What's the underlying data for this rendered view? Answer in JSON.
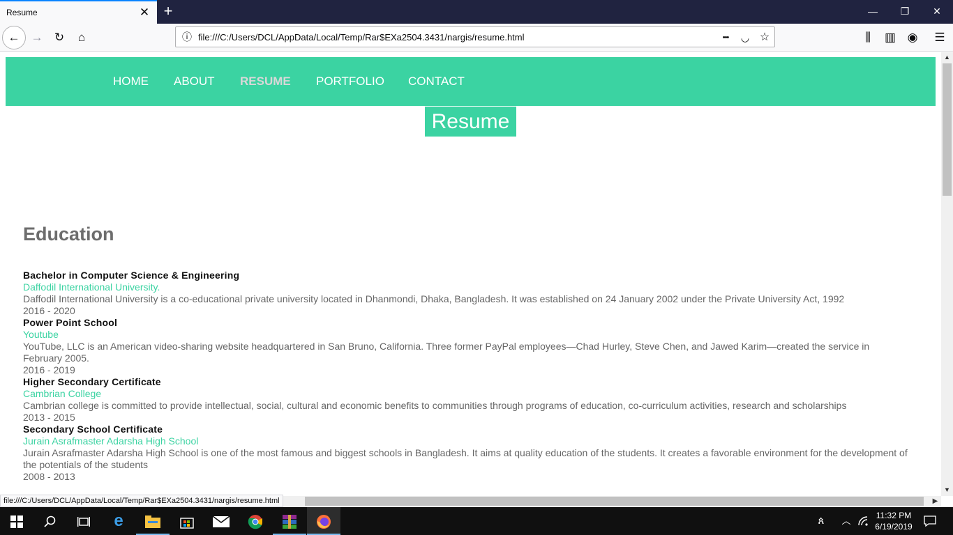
{
  "browser": {
    "tab_title": "Resume",
    "tab_close": "✕",
    "new_tab": "+",
    "url": "file:///C:/Users/DCL/AppData/Local/Temp/Rar$EXa2504.3431/nargis/resume.html",
    "status_url": "file:///C:/Users/DCL/AppData/Local/Temp/Rar$EXa2504.3431/nargis/resume.html",
    "icons": {
      "back": "←",
      "forward": "→",
      "reload": "↻",
      "home": "⌂",
      "info": "ⓘ",
      "more": "•••",
      "pocket": "◡",
      "bookmark": "☆",
      "library": "⫼",
      "sidebar": "▥",
      "account": "◉",
      "menu": "☰",
      "minimize": "—",
      "restore": "❐",
      "close": "✕"
    }
  },
  "nav": {
    "items": [
      "HOME",
      "ABOUT",
      "RESUME",
      "PORTFOLIO",
      "CONTACT"
    ],
    "active": "RESUME"
  },
  "page": {
    "heading": "Resume",
    "section_title": "Education",
    "education": [
      {
        "degree": "Bachelor in Computer Science & Engineering",
        "institution": "Daffodil International University.",
        "description": "Daffodil International University is a co-educational private university located in Dhanmondi, Dhaka, Bangladesh. It was established on 24 January 2002 under the Private University Act, 1992",
        "years": "2016 - 2020"
      },
      {
        "degree": "Power Point School",
        "institution": "Youtube",
        "description": "YouTube, LLC is an American video-sharing website headquartered in San Bruno, California. Three former PayPal employees—Chad Hurley, Steve Chen, and Jawed Karim—created the service in February 2005.",
        "years": "2016 - 2019"
      },
      {
        "degree": "Higher Secondary Certificate",
        "institution": "Cambrian College",
        "description": "Cambrian college is committed to provide intellectual, social, cultural and economic benefits to communities through programs of education, co-curriculum activities, research and scholarships",
        "years": "2013 - 2015"
      },
      {
        "degree": "Secondary School Certificate",
        "institution": "Jurain Asrafmaster Adarsha High School",
        "description": "Jurain Asrafmaster Adarsha High School is one of the most famous and biggest schools in Bangladesh. It aims at quality education of the students. It creates a favorable environment for the development of the potentials of the students",
        "years": "2008 - 2013"
      }
    ]
  },
  "taskbar": {
    "time": "11:32 PM",
    "date": "6/19/2019"
  },
  "colors": {
    "accent": "#3bd3a2",
    "tabbar": "#202340",
    "taskbar": "#101010"
  }
}
